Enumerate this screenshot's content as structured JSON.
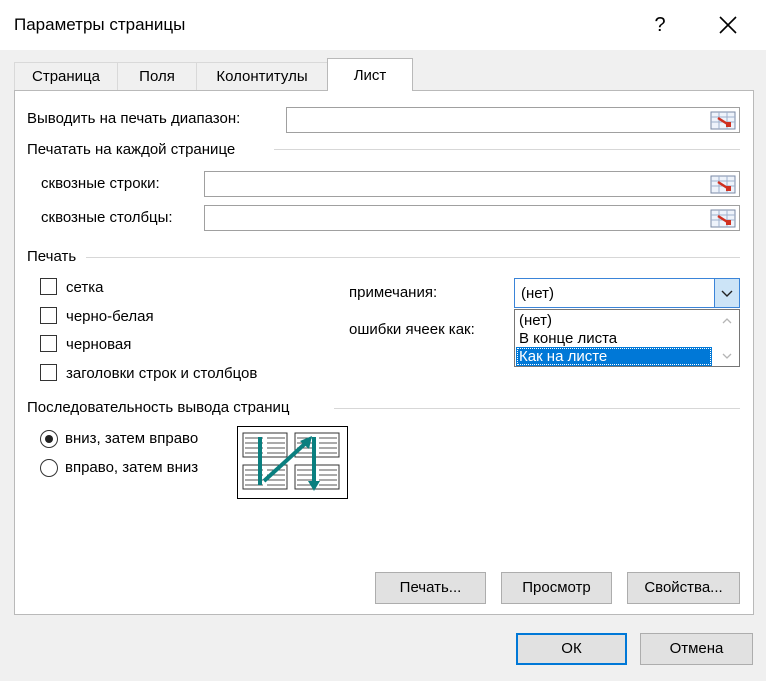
{
  "window": {
    "title": "Параметры страницы",
    "help_glyph": "?"
  },
  "tabs": [
    {
      "label": "Страница"
    },
    {
      "label": "Поля"
    },
    {
      "label": "Колонтитулы"
    },
    {
      "label": "Лист"
    }
  ],
  "sheet": {
    "print_area_label": "Выводить на печать диапазон:",
    "print_titles_section": "Печатать на каждой странице",
    "rows_label": "сквозные строки:",
    "cols_label": "сквозные столбцы:",
    "print_section": "Печать",
    "checkboxes": [
      {
        "label": "сетка",
        "checked": false
      },
      {
        "label": "черно-белая",
        "checked": false
      },
      {
        "label": "черновая",
        "checked": false
      },
      {
        "label": "заголовки строк и столбцов",
        "checked": false
      }
    ],
    "comments_label": "примечания:",
    "comments_value": "(нет)",
    "errors_label": "ошибки ячеек как:",
    "comments_options": [
      "(нет)",
      "В конце листа",
      "Как на листе"
    ],
    "comments_highlighted": "Как на листе",
    "order_section": "Последовательность вывода страниц",
    "order_options": [
      {
        "label": "вниз, затем вправо",
        "selected": true
      },
      {
        "label": "вправо, затем вниз",
        "selected": false
      }
    ]
  },
  "buttons": {
    "print": "Печать...",
    "preview": "Просмотр",
    "properties": "Свойства...",
    "ok": "ОК",
    "cancel": "Отмена"
  },
  "colors": {
    "accent": "#0078d7",
    "arrow": "#0a7f7f"
  }
}
